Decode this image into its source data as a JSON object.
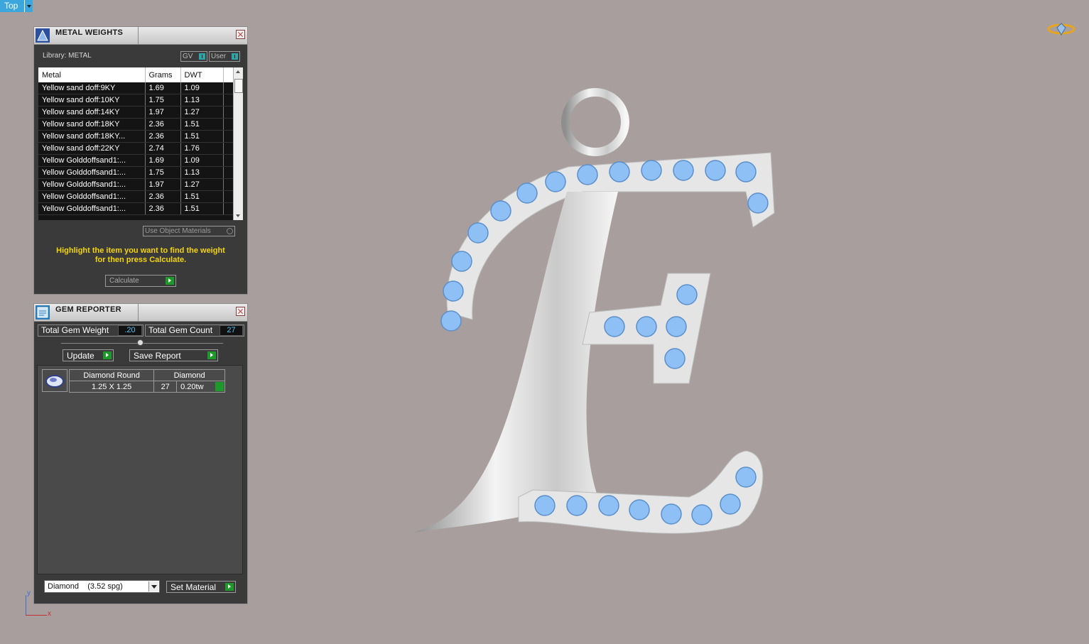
{
  "viewport": {
    "label": "Top",
    "axis_y": "y",
    "axis_x": "x"
  },
  "metal_panel": {
    "title": "METAL WEIGHTS",
    "library": "Library: METAL",
    "toggle_gv": "GV",
    "toggle_user": "User",
    "columns": [
      "Metal",
      "Grams",
      "DWT"
    ],
    "rows": [
      [
        "Yellow sand doff:9KY",
        "1.69",
        "1.09"
      ],
      [
        "Yellow sand doff:10KY",
        "1.75",
        "1.13"
      ],
      [
        "Yellow sand doff:14KY",
        "1.97",
        "1.27"
      ],
      [
        "Yellow sand doff:18KY",
        "2.36",
        "1.51"
      ],
      [
        "Yellow sand doff:18KY...",
        "2.36",
        "1.51"
      ],
      [
        "Yellow sand doff:22KY",
        "2.74",
        "1.76"
      ],
      [
        "Yellow Golddoffsand1:...",
        "1.69",
        "1.09"
      ],
      [
        "Yellow Golddoffsand1:...",
        "1.75",
        "1.13"
      ],
      [
        "Yellow Golddoffsand1:...",
        "1.97",
        "1.27"
      ],
      [
        "Yellow Golddoffsand1:...",
        "2.36",
        "1.51"
      ],
      [
        "Yellow Golddoffsand1:...",
        "2.36",
        "1.51"
      ]
    ],
    "use_object_materials": "Use Object Materials",
    "hint_line1": "Highlight the item you want to find the weight",
    "hint_line2": "for then press Calculate.",
    "calculate_label": "Calculate"
  },
  "gem_panel": {
    "title": "GEM REPORTER",
    "total_weight_label": "Total Gem Weight",
    "total_weight_value": ".20",
    "total_count_label": "Total Gem Count",
    "total_count_value": "27",
    "update_label": "Update",
    "save_report_label": "Save Report",
    "gem": {
      "shape": "Diamond Round",
      "material": "Diamond",
      "size": "1.25 X 1.25",
      "count": "27",
      "weight": "0.20tw"
    },
    "material_select": "Diamond    (3.52 spg)",
    "set_material_label": "Set Material"
  },
  "colors": {
    "background": "#a79e9d",
    "accent": "#3ba7dd",
    "hint": "#f4d50a",
    "go_button": "#1e9a2a",
    "gem_blue": "#8fc0f5"
  },
  "icons": [
    "metal-weights-logo-icon",
    "close-icon",
    "gem-reporter-logo-icon",
    "diamond-view-icon",
    "gem-thumbnail-icon"
  ]
}
